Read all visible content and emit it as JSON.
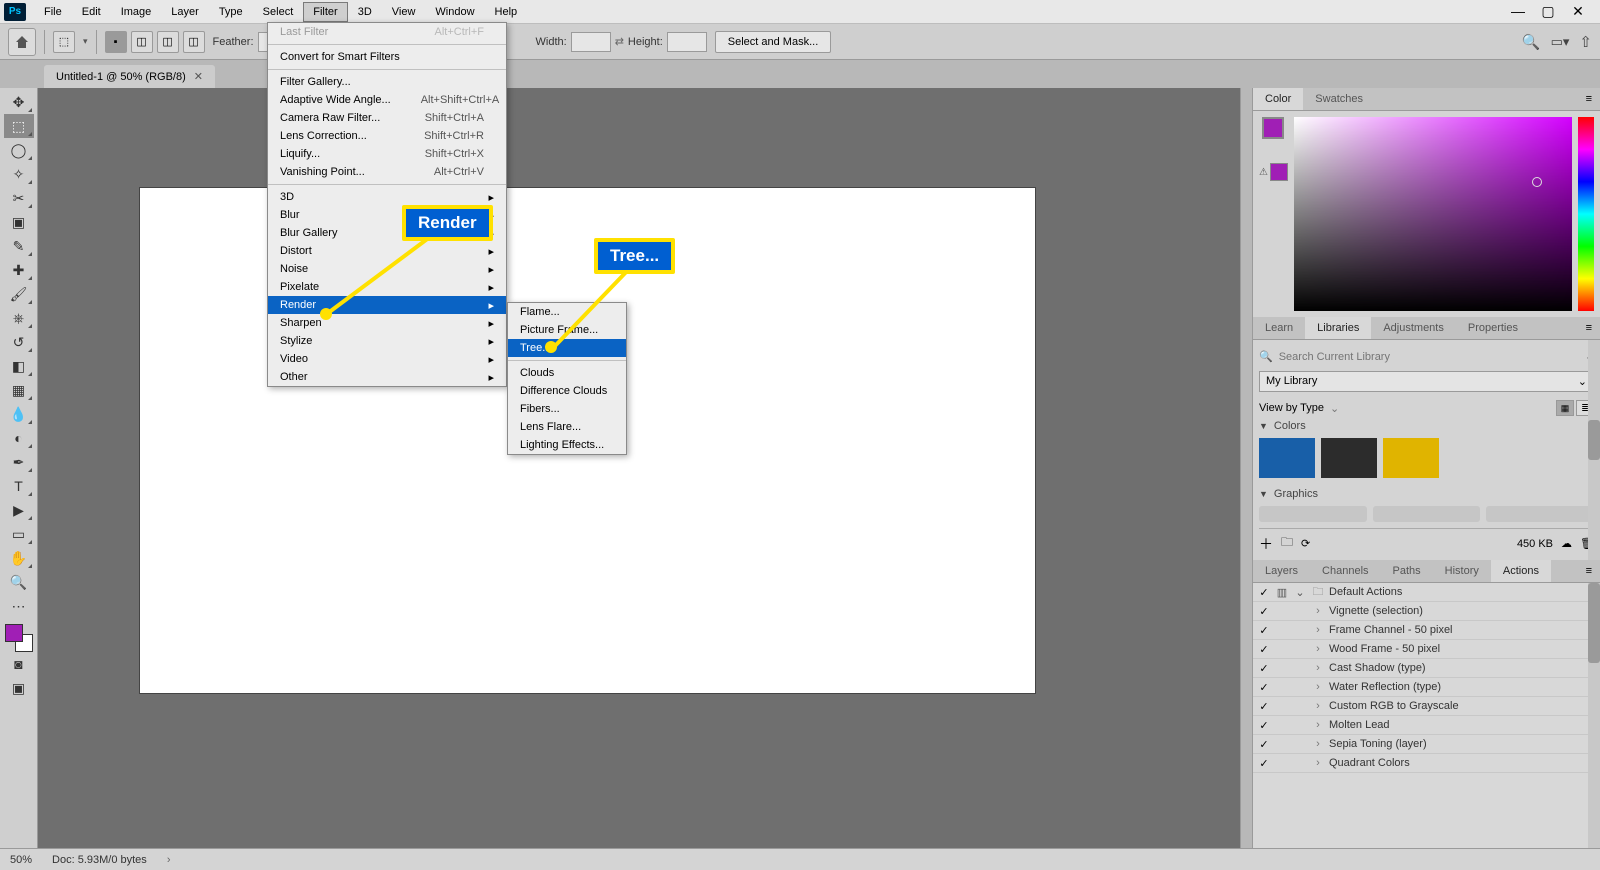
{
  "menubar": [
    "File",
    "Edit",
    "Image",
    "Layer",
    "Type",
    "Select",
    "Filter",
    "3D",
    "View",
    "Window",
    "Help"
  ],
  "menubar_open_index": 6,
  "options": {
    "feather_label": "Feather:",
    "width_label": "Width:",
    "height_label": "Height:",
    "select_mask": "Select and Mask..."
  },
  "doc_tab": "Untitled-1 @ 50% (RGB/8)",
  "filter_menu": {
    "groups": [
      [
        {
          "label": "Last Filter",
          "shortcut": "Alt+Ctrl+F",
          "disabled": true
        }
      ],
      [
        {
          "label": "Convert for Smart Filters"
        }
      ],
      [
        {
          "label": "Filter Gallery..."
        },
        {
          "label": "Adaptive Wide Angle...",
          "shortcut": "Alt+Shift+Ctrl+A"
        },
        {
          "label": "Camera Raw Filter...",
          "shortcut": "Shift+Ctrl+A"
        },
        {
          "label": "Lens Correction...",
          "shortcut": "Shift+Ctrl+R"
        },
        {
          "label": "Liquify...",
          "shortcut": "Shift+Ctrl+X"
        },
        {
          "label": "Vanishing Point...",
          "shortcut": "Alt+Ctrl+V"
        }
      ],
      [
        {
          "label": "3D",
          "sub": true
        },
        {
          "label": "Blur",
          "sub": true
        },
        {
          "label": "Blur Gallery",
          "sub": true
        },
        {
          "label": "Distort",
          "sub": true
        },
        {
          "label": "Noise",
          "sub": true
        },
        {
          "label": "Pixelate",
          "sub": true
        },
        {
          "label": "Render",
          "sub": true,
          "highlight": true
        },
        {
          "label": "Sharpen",
          "sub": true
        },
        {
          "label": "Stylize",
          "sub": true
        },
        {
          "label": "Video",
          "sub": true
        },
        {
          "label": "Other",
          "sub": true
        }
      ]
    ]
  },
  "render_submenu": [
    [
      {
        "label": "Flame..."
      },
      {
        "label": "Picture Frame..."
      },
      {
        "label": "Tree...",
        "highlight": true
      }
    ],
    [
      {
        "label": "Clouds"
      },
      {
        "label": "Difference Clouds"
      },
      {
        "label": "Fibers..."
      },
      {
        "label": "Lens Flare..."
      },
      {
        "label": "Lighting Effects..."
      }
    ]
  ],
  "callout1": "Render",
  "callout2": "Tree...",
  "panel_color": {
    "tabs": [
      "Color",
      "Swatches"
    ],
    "active": 0
  },
  "panel_lib": {
    "tabs": [
      "Learn",
      "Libraries",
      "Adjustments",
      "Properties"
    ],
    "active": 1,
    "search_placeholder": "Search Current Library",
    "library_name": "My Library",
    "view_label": "View by Type",
    "section_colors": "Colors",
    "section_graphics": "Graphics",
    "swatches": [
      "#185fa8",
      "#2c2c2c",
      "#e0b400"
    ],
    "footer_size": "450 KB"
  },
  "panel_actions": {
    "tabs": [
      "Layers",
      "Channels",
      "Paths",
      "History",
      "Actions"
    ],
    "active": 4,
    "group": "Default Actions",
    "items": [
      "Vignette (selection)",
      "Frame Channel - 50 pixel",
      "Wood Frame - 50 pixel",
      "Cast Shadow (type)",
      "Water Reflection (type)",
      "Custom RGB to Grayscale",
      "Molten Lead",
      "Sepia Toning (layer)",
      "Quadrant Colors"
    ]
  },
  "status": {
    "zoom": "50%",
    "doc": "Doc: 5.93M/0 bytes"
  }
}
